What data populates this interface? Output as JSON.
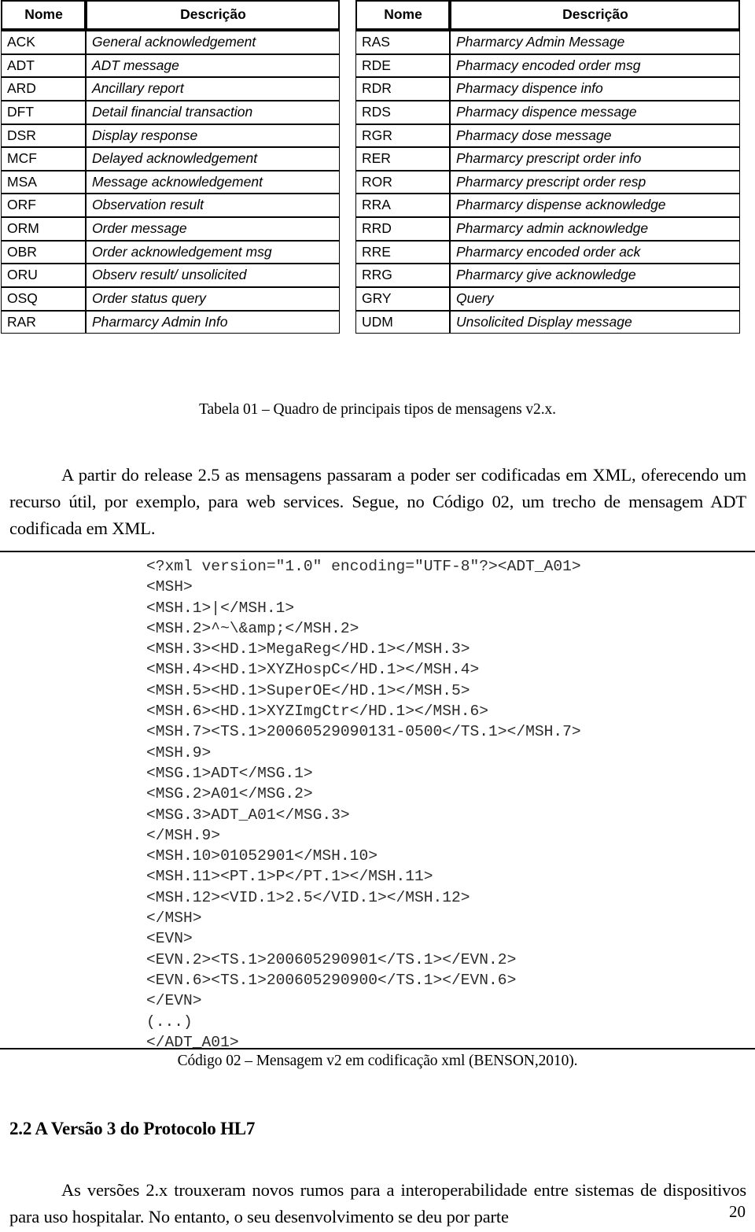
{
  "tables": {
    "headers": {
      "name": "Nome",
      "description": "Descrição"
    },
    "left_rows": [
      {
        "code": "ACK",
        "desc": "General acknowledgement"
      },
      {
        "code": "ADT",
        "desc": "ADT message"
      },
      {
        "code": "ARD",
        "desc": "Ancillary report"
      },
      {
        "code": "DFT",
        "desc": "Detail financial transaction"
      },
      {
        "code": "DSR",
        "desc": "Display response"
      },
      {
        "code": "MCF",
        "desc": "Delayed acknowledgement"
      },
      {
        "code": "MSA",
        "desc": "Message acknowledgement"
      },
      {
        "code": "ORF",
        "desc": "Observation result"
      },
      {
        "code": "ORM",
        "desc": "Order message"
      },
      {
        "code": "OBR",
        "desc": "Order acknowledgement msg"
      },
      {
        "code": "ORU",
        "desc": "Observ result/ unsolicited"
      },
      {
        "code": "OSQ",
        "desc": "Order status query"
      },
      {
        "code": "RAR",
        "desc": "Pharmarcy Admin Info"
      }
    ],
    "right_rows": [
      {
        "code": "RAS",
        "desc": "Pharmarcy Admin Message"
      },
      {
        "code": "RDE",
        "desc": "Pharmacy encoded order msg"
      },
      {
        "code": "RDR",
        "desc": "Pharmacy dispence info"
      },
      {
        "code": "RDS",
        "desc": "Pharmacy dispence message"
      },
      {
        "code": "RGR",
        "desc": "Pharmacy dose message"
      },
      {
        "code": "RER",
        "desc": "Pharmarcy prescript order info"
      },
      {
        "code": "ROR",
        "desc": "Pharmarcy prescript order resp"
      },
      {
        "code": "RRA",
        "desc": "Pharmarcy dispense acknowledge"
      },
      {
        "code": "RRD",
        "desc": "Pharmarcy admin acknowledge"
      },
      {
        "code": "RRE",
        "desc": "Pharmarcy encoded order ack"
      },
      {
        "code": "RRG",
        "desc": "Pharmarcy give acknowledge"
      },
      {
        "code": "GRY",
        "desc": "Query"
      },
      {
        "code": "UDM",
        "desc": "Unsolicited Display message"
      }
    ],
    "caption": "Tabela 01 – Quadro de principais tipos de mensagens v2.x."
  },
  "paragraphs": {
    "xml_intro": "A partir do release 2.5 as mensagens passaram a poder ser codificadas em XML, oferecendo um recurso útil, por exemplo, para web services. Segue, no Código 02, um trecho de mensagem ADT codificada em XML.",
    "v3_intro": "As versões 2.x trouxeram novos rumos para a interoperabilidade entre sistemas de dispositivos para uso hospitalar. No entanto, o seu desenvolvimento se deu por parte"
  },
  "code_block": {
    "content": "<?xml version=\"1.0\" encoding=\"UTF-8\"?><ADT_A01>\n<MSH>\n<MSH.1>|</MSH.1>\n<MSH.2>^~\\&amp;</MSH.2>\n<MSH.3><HD.1>MegaReg</HD.1></MSH.3>\n<MSH.4><HD.1>XYZHospC</HD.1></MSH.4>\n<MSH.5><HD.1>SuperOE</HD.1></MSH.5>\n<MSH.6><HD.1>XYZImgCtr</HD.1></MSH.6>\n<MSH.7><TS.1>20060529090131-0500</TS.1></MSH.7>\n<MSH.9>\n<MSG.1>ADT</MSG.1>\n<MSG.2>A01</MSG.2>\n<MSG.3>ADT_A01</MSG.3>\n</MSH.9>\n<MSH.10>01052901</MSH.10>\n<MSH.11><PT.1>P</PT.1></MSH.11>\n<MSH.12><VID.1>2.5</VID.1></MSH.12>\n</MSH>\n<EVN>\n<EVN.2><TS.1>200605290901</TS.1></EVN.2>\n<EVN.6><TS.1>200605290900</TS.1></EVN.6>\n</EVN>\n(...)\n</ADT_A01>",
    "caption": "Código 02 – Mensagem v2 em codificação xml (BENSON,2010)."
  },
  "section": {
    "heading": "2.2 A Versão 3 do Protocolo HL7"
  },
  "footer": {
    "page_number": "20"
  }
}
